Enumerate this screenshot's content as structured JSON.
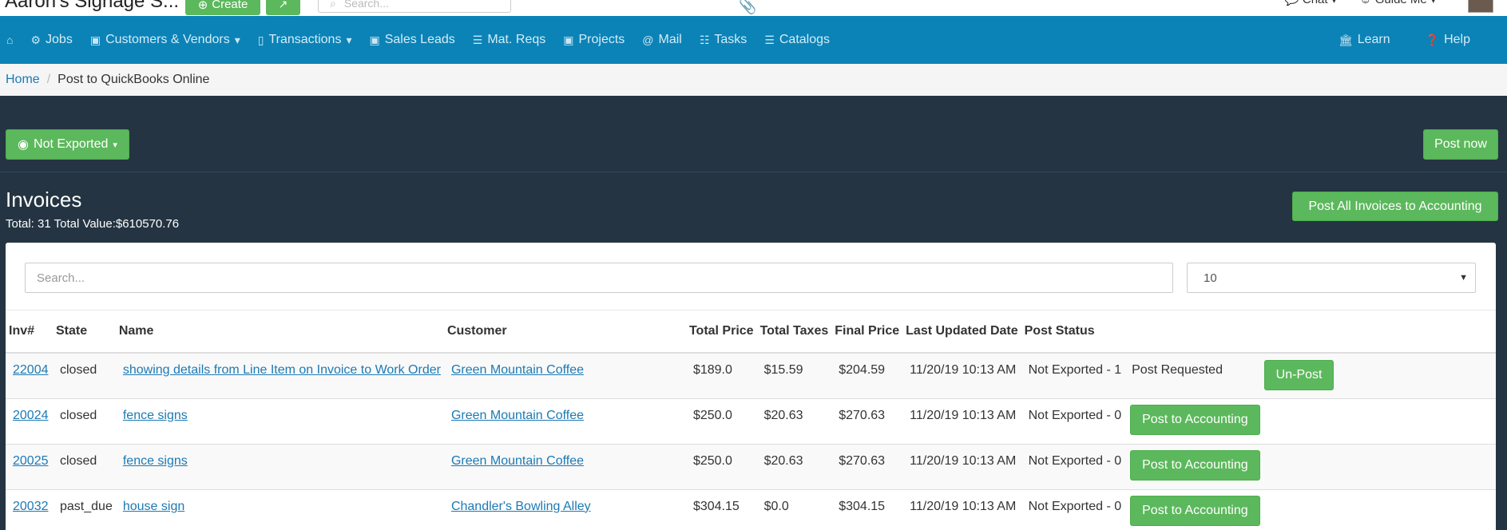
{
  "header": {
    "brand": "Aaron's Signage S...",
    "create_label": "Create",
    "search_placeholder": "Search...",
    "chat_label": "Chat",
    "guide_label": "Guide Me"
  },
  "nav": {
    "jobs": "Jobs",
    "customers": "Customers & Vendors",
    "transactions": "Transactions",
    "sales_leads": "Sales Leads",
    "mat_reqs": "Mat. Reqs",
    "projects": "Projects",
    "mail": "Mail",
    "tasks": "Tasks",
    "catalogs": "Catalogs",
    "learn": "Learn",
    "help": "Help"
  },
  "breadcrumb": {
    "home": "Home",
    "current": "Post to QuickBooks Online"
  },
  "toolbar": {
    "filter_label": "Not Exported",
    "post_now_label": "Post now"
  },
  "invoices": {
    "title": "Invoices",
    "summary": "Total: 31 Total Value:$610570.76",
    "post_all_label": "Post All Invoices to Accounting",
    "search_placeholder": "Search...",
    "page_size": "10",
    "columns": [
      "Inv#",
      "State",
      "Name",
      "Customer",
      "Total Price",
      "Total Taxes",
      "Final Price",
      "Last Updated Date",
      "Post Status",
      "",
      ""
    ],
    "rows": [
      {
        "inv": "22004",
        "state": "closed",
        "name": "showing details from Line Item on Invoice to Work Order",
        "customer": "Green Mountain Coffee",
        "total": "$189.0",
        "taxes": "$15.59",
        "final": "$204.59",
        "updated": "11/20/19 10:13 AM",
        "status": "Not Exported - 1",
        "note": "Post Requested",
        "action": "Un-Post"
      },
      {
        "inv": "20024",
        "state": "closed",
        "name": "fence signs",
        "customer": "Green Mountain Coffee",
        "total": "$250.0",
        "taxes": "$20.63",
        "final": "$270.63",
        "updated": "11/20/19 10:13 AM",
        "status": "Not Exported - 0",
        "note": "",
        "action": "Post to Accounting"
      },
      {
        "inv": "20025",
        "state": "closed",
        "name": "fence signs",
        "customer": "Green Mountain Coffee",
        "total": "$250.0",
        "taxes": "$20.63",
        "final": "$270.63",
        "updated": "11/20/19 10:13 AM",
        "status": "Not Exported - 0",
        "note": "",
        "action": "Post to Accounting"
      },
      {
        "inv": "20032",
        "state": "past_due",
        "name": "house sign",
        "customer": "Chandler's Bowling Alley",
        "total": "$304.15",
        "taxes": "$0.0",
        "final": "$304.15",
        "updated": "11/20/19 10:13 AM",
        "status": "Not Exported - 0",
        "note": "",
        "action": "Post to Accounting"
      }
    ]
  },
  "colors": {
    "nav_bg": "#0b83b7",
    "dark_bg": "#243442",
    "green": "#5cb85c",
    "link": "#1c7ab5"
  }
}
